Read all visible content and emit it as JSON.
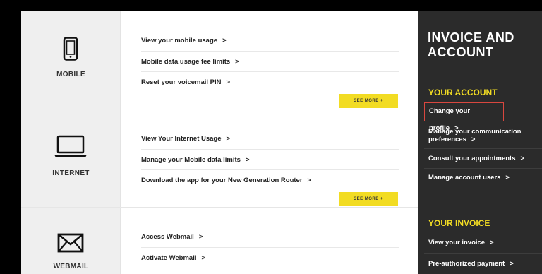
{
  "sections": {
    "mobile": {
      "label": "MOBILE",
      "links": [
        "View your mobile usage",
        "Mobile data usage fee limits",
        "Reset your voicemail PIN"
      ],
      "see_more": "SEE MORE  +"
    },
    "internet": {
      "label": "INTERNET",
      "links": [
        "View Your Internet Usage",
        "Manage your Mobile data limits",
        "Download the app for your New Generation Router"
      ],
      "see_more": "SEE MORE  +"
    },
    "webmail": {
      "label": "WEBMAIL",
      "links": [
        "Access Webmail",
        "Activate Webmail"
      ]
    }
  },
  "arrow": ">",
  "sidebar": {
    "title": "INVOICE AND ACCOUNT",
    "account_heading": "YOUR ACCOUNT",
    "account_items": [
      "Change your profile",
      "Manage your communication preferences",
      "Consult your appointments",
      "Manage account users"
    ],
    "invoice_heading": "YOUR INVOICE",
    "invoice_items": [
      "View your invoice",
      "Pre-authorized payment"
    ]
  },
  "colors": {
    "accent": "#f2dc23",
    "sidebar_bg": "#2b2b2b",
    "highlight_border": "#d9473f"
  }
}
